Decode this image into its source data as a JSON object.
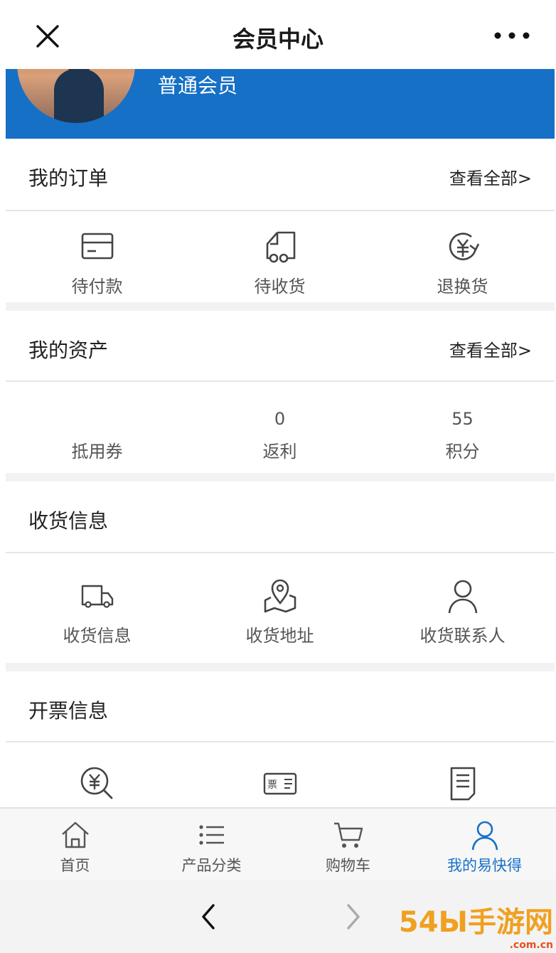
{
  "header": {
    "title": "会员中心",
    "close_icon": "close-icon",
    "more_icon": "more-dots-icon"
  },
  "profile": {
    "level": "普通会员",
    "avatar": "avatar-photo"
  },
  "orders": {
    "title": "我的订单",
    "view_all": "查看全部>",
    "items": [
      {
        "label": "待付款",
        "icon": "wallet-card-icon"
      },
      {
        "label": "待收货",
        "icon": "delivery-truck-icon"
      },
      {
        "label": "退换货",
        "icon": "yen-refund-icon"
      }
    ]
  },
  "assets": {
    "title": "我的资产",
    "view_all": "查看全部>",
    "items": [
      {
        "label": "抵用券",
        "value": ""
      },
      {
        "label": "返利",
        "value": "0"
      },
      {
        "label": "积分",
        "value": "55"
      }
    ]
  },
  "shipping": {
    "title": "收货信息",
    "items": [
      {
        "label": "收货信息",
        "icon": "truck-icon"
      },
      {
        "label": "收货地址",
        "icon": "map-pin-icon"
      },
      {
        "label": "收货联系人",
        "icon": "person-icon"
      }
    ]
  },
  "invoice": {
    "title": "开票信息",
    "items": [
      {
        "icon": "yen-search-icon"
      },
      {
        "icon": "ticket-icon",
        "glyph": "票"
      },
      {
        "icon": "document-icon"
      }
    ]
  },
  "tabbar": {
    "active_color": "#1670c6",
    "items": [
      {
        "label": "首页",
        "icon": "home-icon"
      },
      {
        "label": "产品分类",
        "icon": "list-icon"
      },
      {
        "label": "购物车",
        "icon": "cart-icon"
      },
      {
        "label": "我的易快得",
        "icon": "user-icon"
      }
    ]
  },
  "browser": {
    "back_icon": "back-arrow-icon",
    "forward_icon": "forward-arrow-icon"
  },
  "watermark": {
    "text": "54Ы手游网",
    "sub": ".com.cn"
  },
  "colors": {
    "brand": "#1670c6",
    "divider": "#e6e6e6",
    "page_gap": "#f2f2f4"
  }
}
